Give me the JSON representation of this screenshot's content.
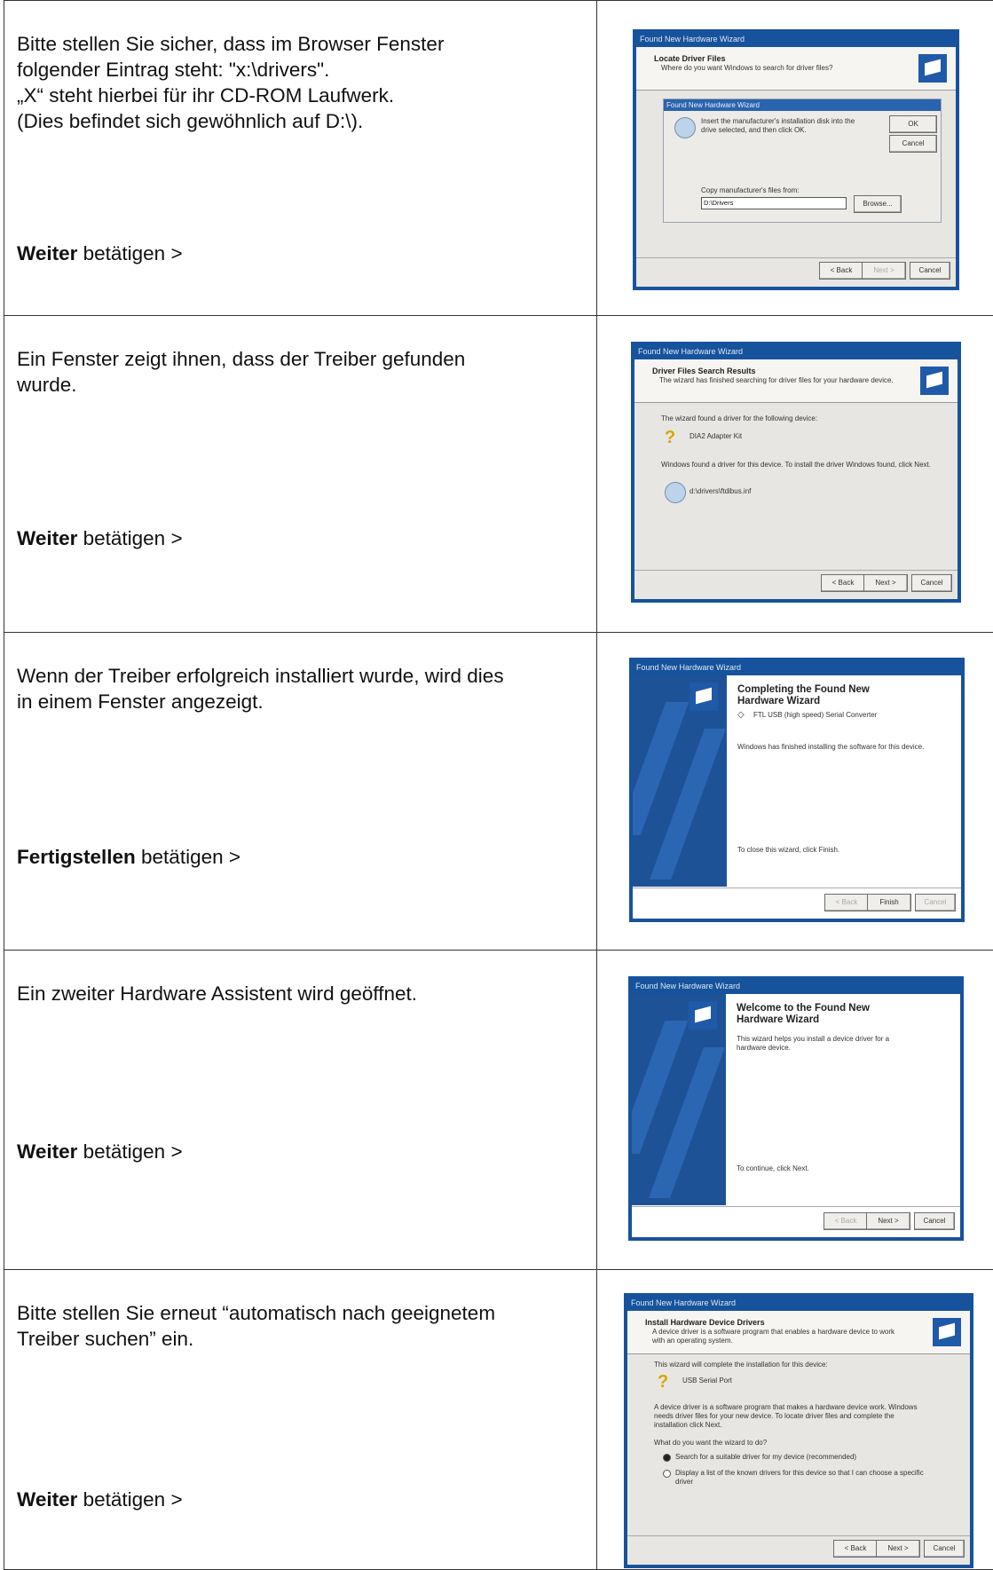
{
  "rows": [
    {
      "description": [
        "Bitte stellen Sie sicher, dass im Browser Fenster",
        "folgender Eintrag steht: \"x:\\drivers\".",
        "„X“ steht hierbei für ihr CD-ROM Laufwerk.",
        "(Dies befindet sich gewöhnlich auf D:\\)."
      ],
      "action": {
        "bold": "Weiter",
        "rest": " betätigen >"
      },
      "wizard": {
        "title": "Found New Hardware Wizard",
        "header_title": "Locate Driver Files",
        "header_sub": "Where do you want Windows to search for driver files?",
        "dialog_title": "Found New Hardware Wizard",
        "dialog_text": "Insert the manufacturer's installation disk into the drive selected, and then click OK.",
        "ok_label": "OK",
        "cancel_label": "Cancel",
        "copy_label": "Copy manufacturer's files from:",
        "path_value": "D:\\Drivers",
        "browse_label": "Browse...",
        "back_label": "< Back",
        "next_label": "Next >",
        "footer_cancel": "Cancel"
      }
    },
    {
      "description": [
        "Ein Fenster zeigt ihnen, dass der Treiber gefunden",
        "wurde."
      ],
      "action": {
        "bold": "Weiter",
        "rest": " betätigen >"
      },
      "wizard": {
        "title": "Found New Hardware Wizard",
        "header_title": "Driver Files Search Results",
        "header_sub": "The wizard has finished searching for driver files for your hardware device.",
        "line1": "The wizard found a driver for the following device:",
        "device": "DIA2 Adapter Kit",
        "line2": "Windows found a driver for this device. To install the driver Windows found, click Next.",
        "file": "d:\\drivers\\ftdibus.inf",
        "back_label": "< Back",
        "next_label": "Next >",
        "cancel_label": "Cancel"
      }
    },
    {
      "description": [
        "Wenn der Treiber  erfolgreich installiert wurde, wird dies",
        "in einem Fenster angezeigt."
      ],
      "action": {
        "bold": "Fertigstellen",
        "rest": " betätigen >"
      },
      "wizard": {
        "title": "Found New Hardware Wizard",
        "big_title": [
          "Completing the Found New",
          "Hardware Wizard"
        ],
        "device": "FTL USB (high speed) Serial Converter",
        "line1": "Windows has finished installing the software for this device.",
        "line2": "To close this wizard, click Finish.",
        "back_label": "< Back",
        "finish_label": "Finish",
        "cancel_label": "Cancel"
      }
    },
    {
      "description": [
        "Ein zweiter Hardware Assistent wird geöffnet."
      ],
      "action": {
        "bold": "Weiter",
        "rest": " betätigen >"
      },
      "wizard": {
        "title": "Found New Hardware Wizard",
        "big_title": [
          "Welcome to the Found New",
          "Hardware Wizard"
        ],
        "line1": "This wizard helps you install a device driver for a",
        "line1b": "hardware device.",
        "line2": "To continue, click Next.",
        "back_label": "< Back",
        "next_label": "Next >",
        "cancel_label": "Cancel"
      }
    },
    {
      "description": [
        "Bitte stellen Sie erneut “automatisch nach geeignetem",
        "Treiber suchen” ein."
      ],
      "action": {
        "bold": "Weiter",
        "rest": " betätigen >"
      },
      "wizard": {
        "title": "Found New Hardware Wizard",
        "header_title": "Install Hardware Device Drivers",
        "header_sub": "A device driver is a software program that enables a hardware device to work with an operating system.",
        "line1": "This wizard will complete the installation for this device:",
        "device": "USB Serial Port",
        "line2a": "A device driver is a software program that makes a hardware device work. Windows",
        "line2b": "needs driver files for your new device. To locate driver files and complete the",
        "line2c": "installation click Next.",
        "question": "What do you want the wizard to do?",
        "option1": "Search for a suitable driver for my device (recommended)",
        "option2a": "Display a list of the known drivers for this device so that I can choose a specific",
        "option2b": "driver",
        "back_label": "< Back",
        "next_label": "Next >",
        "cancel_label": "Cancel"
      }
    }
  ]
}
